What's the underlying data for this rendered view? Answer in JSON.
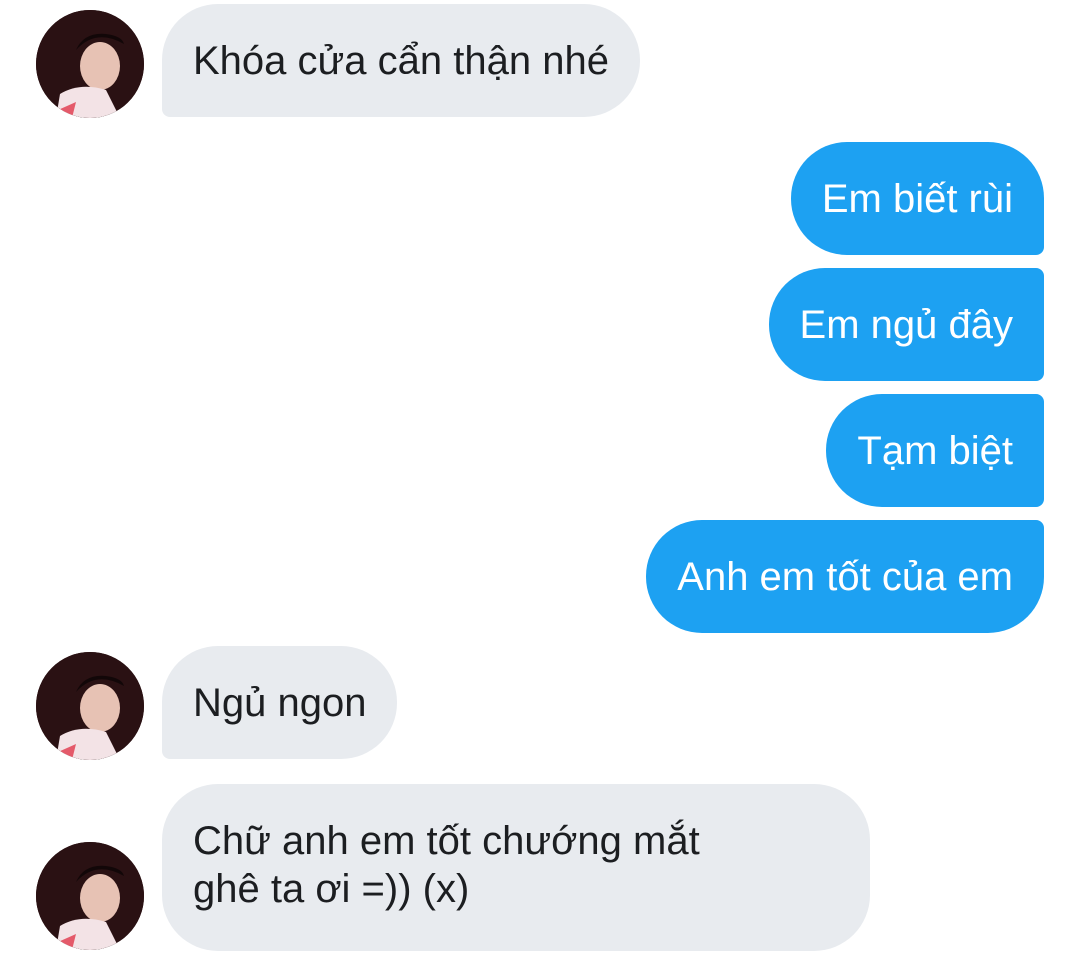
{
  "messages": [
    {
      "sender": "other",
      "text": "Khóa cửa cẩn thận nhé"
    },
    {
      "sender": "me",
      "text": "Em biết rùi"
    },
    {
      "sender": "me",
      "text": "Em ngủ đây"
    },
    {
      "sender": "me",
      "text": "Tạm biệt"
    },
    {
      "sender": "me",
      "text": "Anh em tốt của em"
    },
    {
      "sender": "other",
      "text": "Ngủ ngon"
    },
    {
      "sender": "other",
      "lines": [
        "Chữ anh em tốt chướng mắt",
        "ghê ta ơi =)) (x)"
      ]
    }
  ],
  "colors": {
    "outgoing_bubble": "#1da1f2",
    "incoming_bubble": "#e8ebef",
    "background": "#ffffff"
  },
  "icons": {
    "avatar": "contact-avatar-photo"
  }
}
